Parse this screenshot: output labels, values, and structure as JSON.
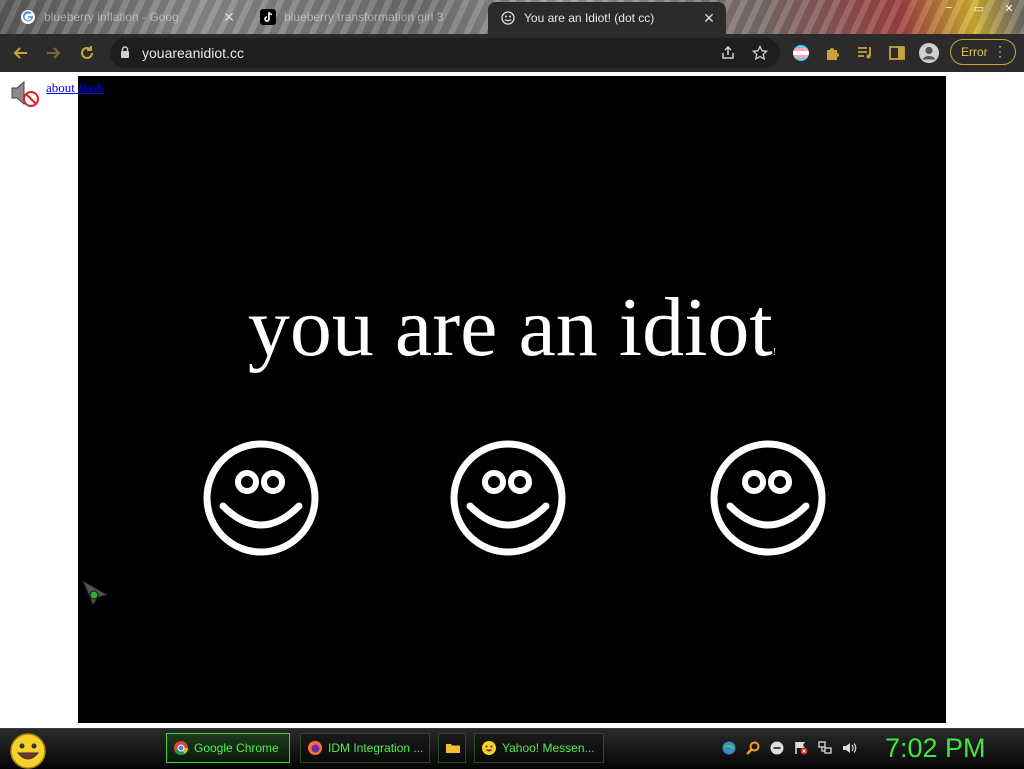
{
  "browser": {
    "tabs": [
      {
        "title": "blueberry inflation - Goog",
        "icon": "google-icon",
        "active": false
      },
      {
        "title": "blueberry transformation girl 3",
        "icon": "tiktok-icon",
        "active": false
      },
      {
        "title": "You are an Idiot! (dot cc)",
        "icon": "smiley-icon",
        "active": true
      }
    ],
    "window_controls": [
      "−",
      "▭",
      "✕"
    ],
    "url": "youareanidiot.cc",
    "error_label": "Error",
    "accent_color": "#c8a43a"
  },
  "page": {
    "link_text": "about flash",
    "headline": "you are an idiot",
    "headline_mark": "!",
    "smiley_count": 3
  },
  "taskbar": {
    "tasks": [
      {
        "label": "Google Chrome",
        "icon": "chrome-icon",
        "active": true
      },
      {
        "label": "IDM Integration ...",
        "icon": "firefox-icon",
        "active": false
      },
      {
        "label": "",
        "icon": "folder-icon",
        "active": false
      },
      {
        "label": "Yahoo! Messen...",
        "icon": "yahoo-messenger-icon",
        "active": false
      }
    ],
    "clock": "7:02 PM",
    "clock_color": "#3fe83f"
  }
}
